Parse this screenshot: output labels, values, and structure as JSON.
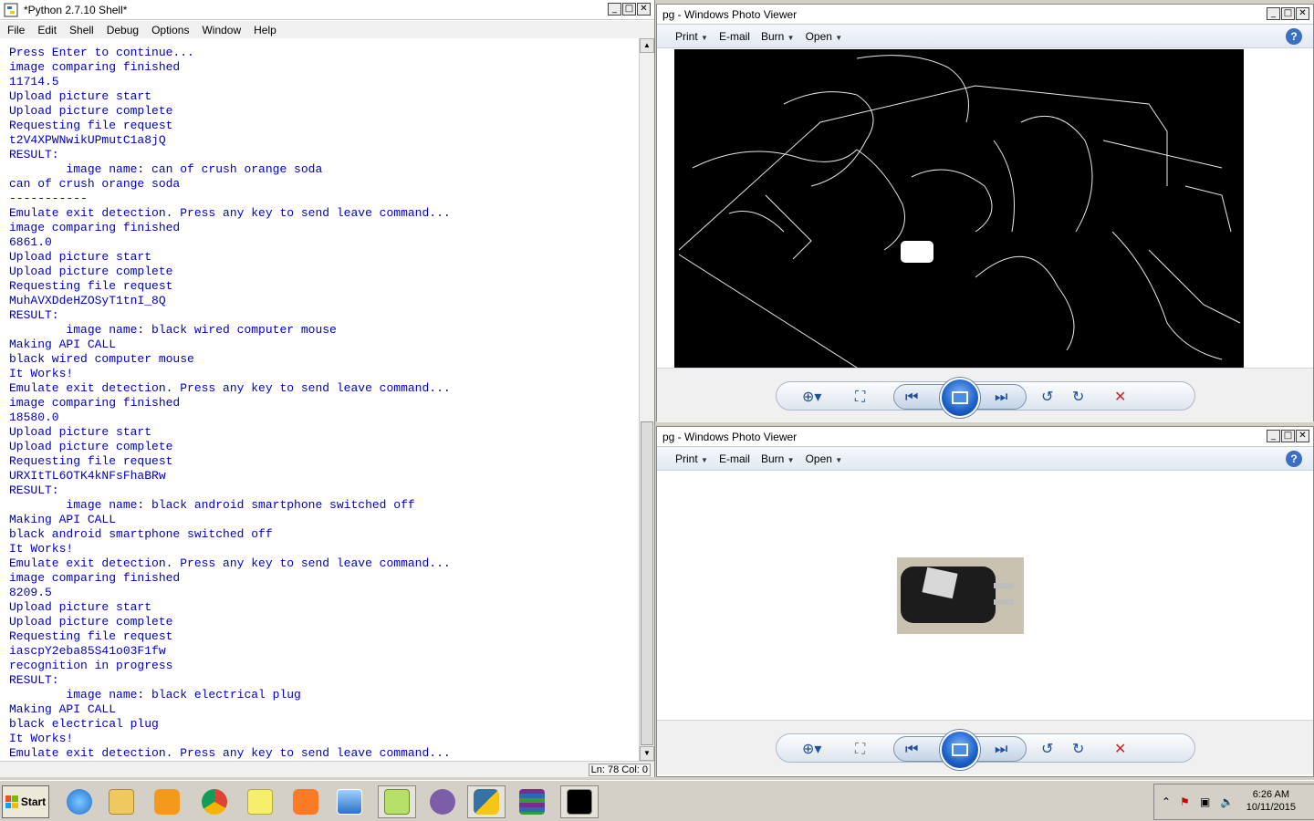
{
  "shell": {
    "title": "*Python 2.7.10 Shell*",
    "menu": [
      "File",
      "Edit",
      "Shell",
      "Debug",
      "Options",
      "Window",
      "Help"
    ],
    "console_lines": [
      "Press Enter to continue...",
      "image comparing finished",
      "11714.5",
      "Upload picture start",
      "Upload picture complete",
      "Requesting file request",
      "t2V4XPWNwikUPmutC1a8jQ",
      "RESULT:",
      "        image name: can of crush orange soda",
      "can of crush orange soda",
      "-----------",
      "Emulate exit detection. Press any key to send leave command...",
      "image comparing finished",
      "6861.0",
      "Upload picture start",
      "Upload picture complete",
      "Requesting file request",
      "MuhAVXDdeHZOSyT1tnI_8Q",
      "RESULT:",
      "        image name: black wired computer mouse",
      "Making API CALL",
      "black wired computer mouse",
      "It Works!",
      "Emulate exit detection. Press any key to send leave command...",
      "image comparing finished",
      "18580.0",
      "Upload picture start",
      "Upload picture complete",
      "Requesting file request",
      "URXItTL6OTK4kNFsFhaBRw",
      "RESULT:",
      "        image name: black android smartphone switched off",
      "Making API CALL",
      "black android smartphone switched off",
      "It Works!",
      "Emulate exit detection. Press any key to send leave command...",
      "image comparing finished",
      "8209.5",
      "Upload picture start",
      "Upload picture complete",
      "Requesting file request",
      "iascpY2eba85S41o03F1fw",
      "recognition in progress",
      "RESULT:",
      "        image name: black electrical plug",
      "Making API CALL",
      "black electrical plug",
      "It Works!",
      "Emulate exit detection. Press any key to send leave command..."
    ],
    "status": "Ln: 78 Col: 0"
  },
  "viewer1": {
    "title": "pg - Windows Photo Viewer",
    "toolbar": [
      "Print",
      "E-mail",
      "Burn",
      "Open"
    ]
  },
  "viewer2": {
    "title": "pg - Windows Photo Viewer",
    "toolbar": [
      "Print",
      "E-mail",
      "Burn",
      "Open"
    ]
  },
  "taskbar": {
    "start_label": "Start",
    "time": "6:26 AM",
    "date": "10/11/2015"
  }
}
